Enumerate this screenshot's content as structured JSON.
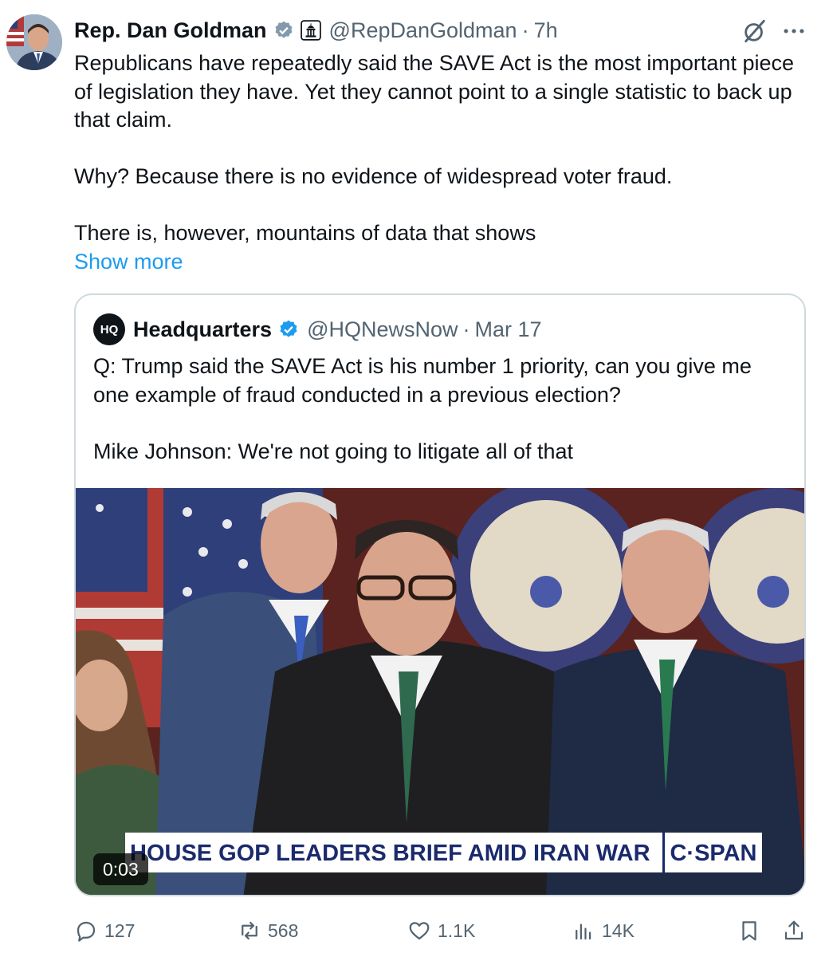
{
  "tweet": {
    "author_name": "Rep. Dan Goldman",
    "handle": "@RepDanGoldman",
    "separator": "·",
    "time": "7h",
    "paragraphs": [
      "Republicans have repeatedly said the SAVE Act is the most important piece of legislation they have. Yet they cannot point to a single statistic to back up that claim.",
      "Why? Because there is no evidence of widespread voter fraud.",
      "There is, however, mountains of data that shows"
    ],
    "show_more": "Show more"
  },
  "quote": {
    "logo_text": "HQ",
    "author_name": "Headquarters",
    "handle": "@HQNewsNow",
    "separator": "·",
    "time": "Mar 17",
    "paragraphs": [
      "Q: Trump said the SAVE Act is his number 1 priority, can you give me one example of fraud conducted in a previous election?",
      "Mike Johnson: We're not going to litigate all of that"
    ],
    "video": {
      "chyron": "HOUSE GOP LEADERS BRIEF AMID IRAN WAR",
      "network": "C·SPAN",
      "timestamp": "0:03"
    }
  },
  "actions": {
    "replies": "127",
    "reposts": "568",
    "likes": "1.1K",
    "views": "14K"
  },
  "colors": {
    "accent": "#1d9bf0",
    "secondary_text": "#536471",
    "border": "#cfd9de"
  }
}
